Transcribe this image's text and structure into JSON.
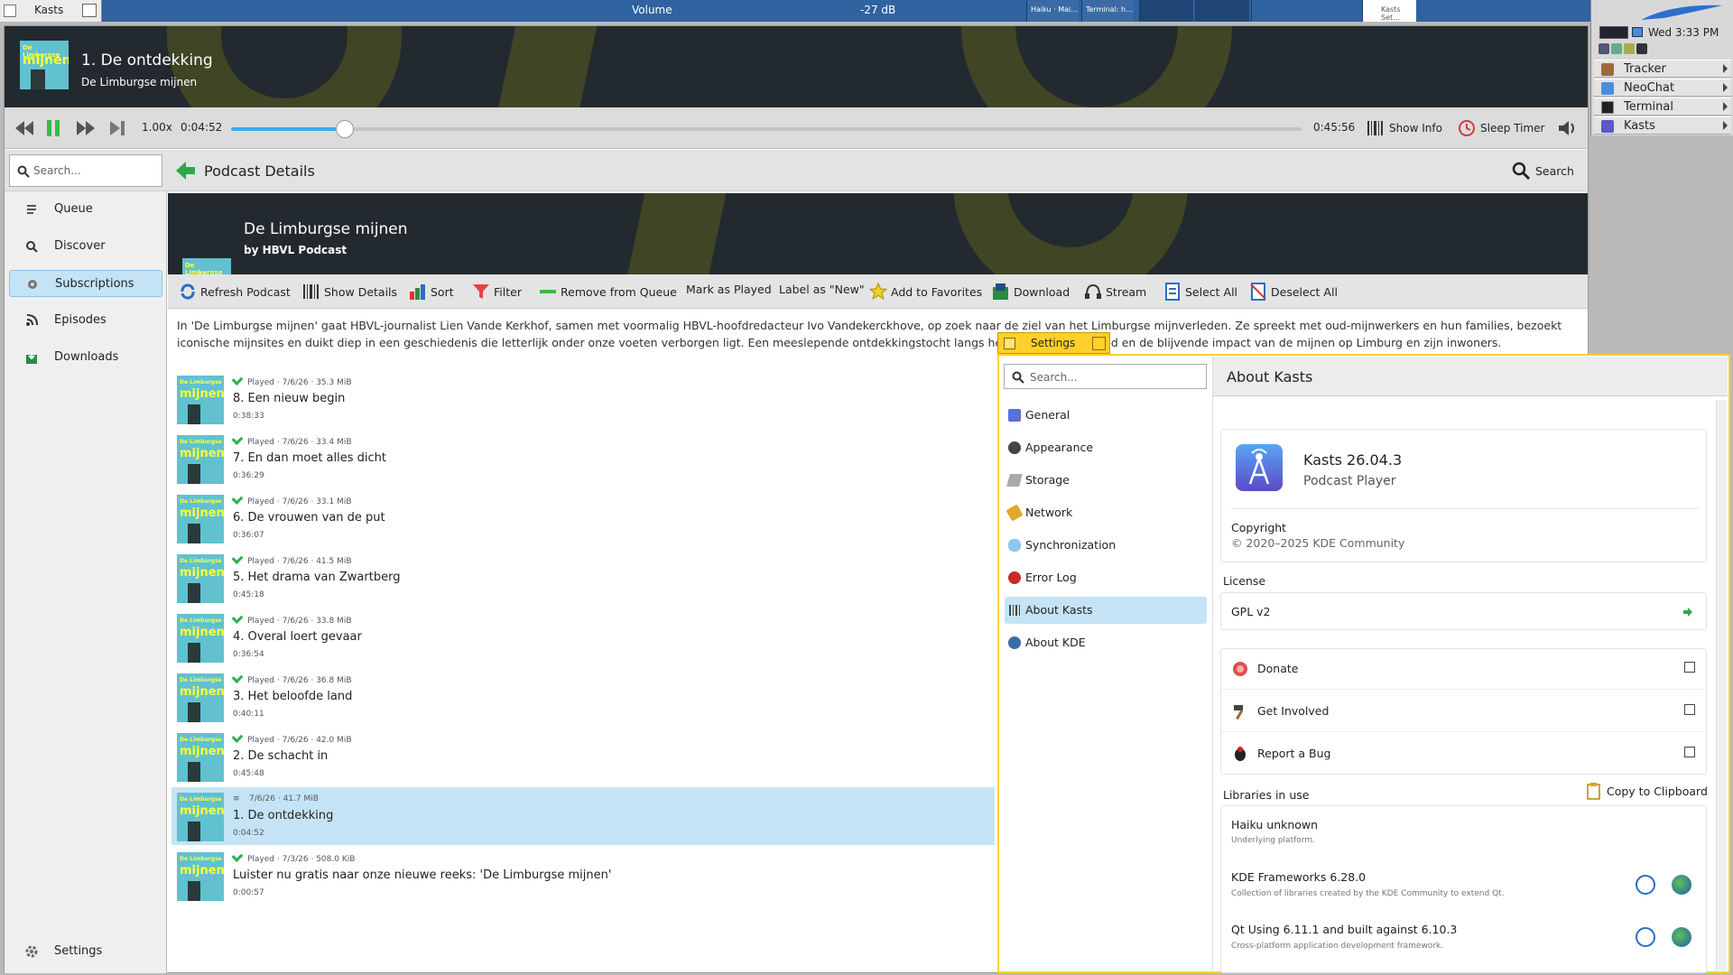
{
  "taskbar": {
    "app_label": "Kasts",
    "volume_label": "Volume",
    "volume_db": "-27 dB",
    "mini_windows": [
      "Haiku · Mai…",
      "Terminal: h…",
      "Kasts Set…"
    ]
  },
  "deskbar": {
    "clock": "Wed 3:33 PM",
    "apps": [
      {
        "label": "Tracker"
      },
      {
        "label": "NeoChat"
      },
      {
        "label": "Terminal"
      },
      {
        "label": "Kasts"
      }
    ]
  },
  "now_playing": {
    "title": "1. De ontdekking",
    "podcast": "De Limburgse mijnen",
    "rate": "1.00x",
    "position": "0:04:52",
    "duration": "0:45:56",
    "progress_fraction": 0.106,
    "show_info_label": "Show Info",
    "sleep_timer_label": "Sleep Timer"
  },
  "search": {
    "placeholder": "Search...",
    "button_label": "Search"
  },
  "page_title": "Podcast Details",
  "sidebar": {
    "items": [
      {
        "label": "Queue",
        "icon": "queue-icon"
      },
      {
        "label": "Discover",
        "icon": "search-icon"
      },
      {
        "label": "Subscriptions",
        "icon": "subscriptions-icon"
      },
      {
        "label": "Episodes",
        "icon": "rss-icon"
      },
      {
        "label": "Downloads",
        "icon": "download-icon"
      }
    ],
    "selected": "Subscriptions",
    "settings_label": "Settings"
  },
  "podcast": {
    "name": "De Limburgse mijnen",
    "author": "by HBVL Podcast",
    "cover_text_small": "De Limburgse",
    "cover_text": "mijnen",
    "description": "In 'De Limburgse mijnen' gaat HBVL-journalist Lien Vande Kerkhof, samen met voormalig HBVL-hoofdredacteur Ivo Vandekerckhove, op zoek naar de ziel van het Limburgse mijnverleden. Ze spreekt met oud-mijnwerkers en hun families, bezoekt iconische mijnsites en duikt diep in een geschiedenis die letterlijk onder onze voeten verborgen ligt. Een meeslepende ontdekkingstocht langs herinneringen, erfgoed en de blijvende impact van de mijnen op Limburg en zijn inwoners."
  },
  "toolbar": {
    "actions": [
      "Refresh Podcast",
      "Show Details",
      "Sort",
      "Filter",
      "Remove from Queue",
      "Mark as Played",
      "Label as \"New\"",
      "Add to Favorites",
      "Download",
      "Stream",
      "Select All",
      "Deselect All"
    ]
  },
  "episodes": [
    {
      "status": "Played",
      "date": "7/6/26",
      "size": "35.3 MiB",
      "title": "8. Een nieuw begin",
      "duration": "0:38:33"
    },
    {
      "status": "Played",
      "date": "7/6/26",
      "size": "33.4 MiB",
      "title": "7. En dan moet alles dicht",
      "duration": "0:36:29"
    },
    {
      "status": "Played",
      "date": "7/6/26",
      "size": "33.1 MiB",
      "title": "6. De vrouwen van de put",
      "duration": "0:36:07"
    },
    {
      "status": "Played",
      "date": "7/6/26",
      "size": "41.5 MiB",
      "title": "5. Het drama van Zwartberg",
      "duration": "0:45:18"
    },
    {
      "status": "Played",
      "date": "7/6/26",
      "size": "33.8 MiB",
      "title": "4. Overal loert gevaar",
      "duration": "0:36:54"
    },
    {
      "status": "Played",
      "date": "7/6/26",
      "size": "36.8 MiB",
      "title": "3. Het beloofde land",
      "duration": "0:40:11"
    },
    {
      "status": "Played",
      "date": "7/6/26",
      "size": "42.0 MiB",
      "title": "2. De schacht in",
      "duration": "0:45:48"
    },
    {
      "status": "",
      "date": "7/6/26",
      "size": "41.7 MiB",
      "title": "1. De ontdekking",
      "duration": "0:04:52"
    },
    {
      "status": "Played",
      "date": "7/3/26",
      "size": "508.0 KiB",
      "title": "Luister nu gratis naar onze nieuwe reeks: 'De Limburgse mijnen'",
      "duration": "0:00:57"
    }
  ],
  "settings": {
    "window_title": "Settings",
    "search_placeholder": "Search...",
    "page_title": "About Kasts",
    "nav": [
      {
        "label": "General",
        "icon": "general-icon"
      },
      {
        "label": "Appearance",
        "icon": "appearance-icon"
      },
      {
        "label": "Storage",
        "icon": "storage-icon"
      },
      {
        "label": "Network",
        "icon": "network-icon"
      },
      {
        "label": "Synchronization",
        "icon": "sync-icon"
      },
      {
        "label": "Error Log",
        "icon": "error-log-icon"
      },
      {
        "label": "About Kasts",
        "icon": "about-kasts-icon"
      },
      {
        "label": "About KDE",
        "icon": "kde-icon"
      }
    ],
    "selected": "About Kasts",
    "about": {
      "app_name": "Kasts 26.04.3",
      "app_subtitle": "Podcast Player",
      "copyright_label": "Copyright",
      "copyright_value": "© 2020–2025 KDE Community",
      "license_heading": "License",
      "license_value": "GPL v2",
      "links": [
        {
          "label": "Donate",
          "icon": "donate-icon"
        },
        {
          "label": "Get Involved",
          "icon": "hammer-icon"
        },
        {
          "label": "Report a Bug",
          "icon": "bug-icon"
        }
      ],
      "libraries_heading": "Libraries in use",
      "copy_clipboard_label": "Copy to Clipboard",
      "libraries": [
        {
          "name": "Haiku unknown",
          "desc": "Underlying platform."
        },
        {
          "name": "KDE Frameworks 6.28.0",
          "desc": "Collection of libraries created by the KDE Community to extend Qt."
        },
        {
          "name": "Qt Using 6.11.1 and built against 6.10.3",
          "desc": "Cross-platform application development framework."
        }
      ]
    }
  }
}
